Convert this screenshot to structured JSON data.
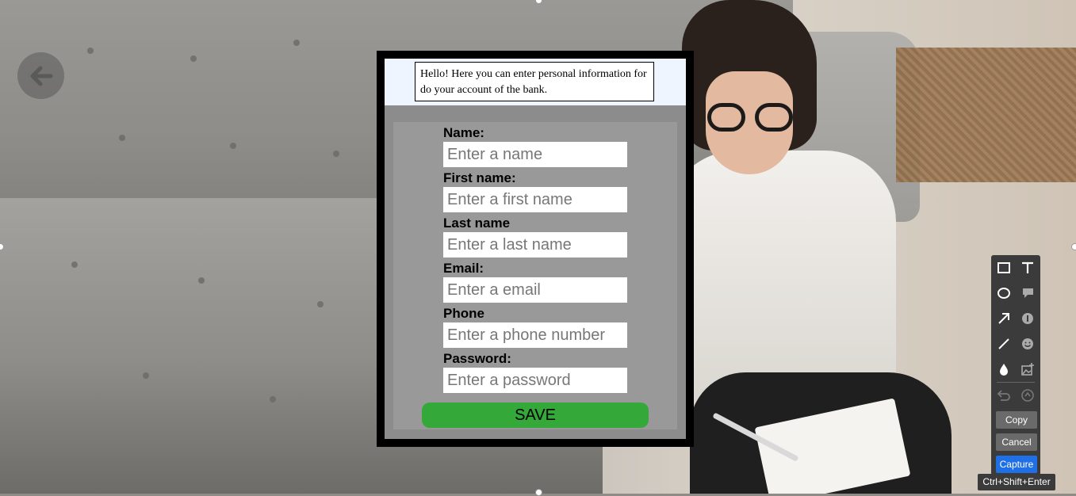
{
  "intro": {
    "text": "Hello! Here you can enter personal information for do your account of the bank."
  },
  "form": {
    "fields": [
      {
        "label": "Name:",
        "placeholder": "Enter a name"
      },
      {
        "label": "First name:",
        "placeholder": "Enter a first name"
      },
      {
        "label": "Last name",
        "placeholder": "Enter a last name"
      },
      {
        "label": "Email:",
        "placeholder": "Enter a email"
      },
      {
        "label": "Phone",
        "placeholder": "Enter a phone number"
      },
      {
        "label": "Password:",
        "placeholder": "Enter a password"
      }
    ],
    "save_label": "SAVE",
    "save_color": "#35a83a"
  },
  "toolbar": {
    "tools": [
      "rectangle-icon",
      "text-icon",
      "ellipse-icon",
      "callout-icon",
      "arrow-icon",
      "number-badge-icon",
      "pen-icon",
      "emoji-icon",
      "blur-icon",
      "image-add-icon",
      "undo-icon",
      "redo-icon"
    ],
    "copy_label": "Copy",
    "cancel_label": "Cancel",
    "capture_label": "Capture",
    "shortcut": "Ctrl+Shift+Enter",
    "capture_color": "#1f6fe6"
  },
  "back_button": {
    "icon": "arrow-left-icon"
  }
}
